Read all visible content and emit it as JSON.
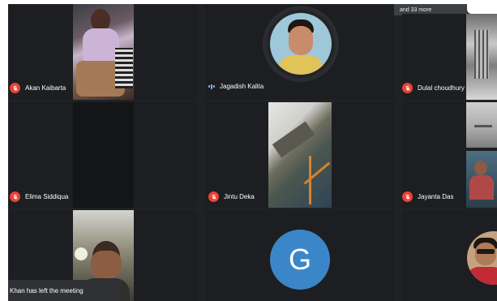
{
  "top_bar": {
    "more_text": "and 33 more"
  },
  "participants": {
    "akan": {
      "name": "Akan Kaibarta"
    },
    "jagadish": {
      "name": "Jagadish Kalita"
    },
    "dulal": {
      "name": "Dulal choudhury"
    },
    "elima": {
      "name": "Elima Siddiqua"
    },
    "jintu": {
      "name": "Jintu Deka"
    },
    "jayanta": {
      "name": "Jayanta Das"
    },
    "g_user": {
      "initial": "G"
    }
  },
  "toast": {
    "text": "Khan has left the meeting"
  },
  "colors": {
    "stage_bg": "#202124",
    "tile_bg": "#1d1e21",
    "mic_muted": "#ea4335",
    "avatar_g": "#3b86c8"
  },
  "icons": [
    "mic-off-icon",
    "audio-active-icon",
    "user-avatar-icon"
  ]
}
